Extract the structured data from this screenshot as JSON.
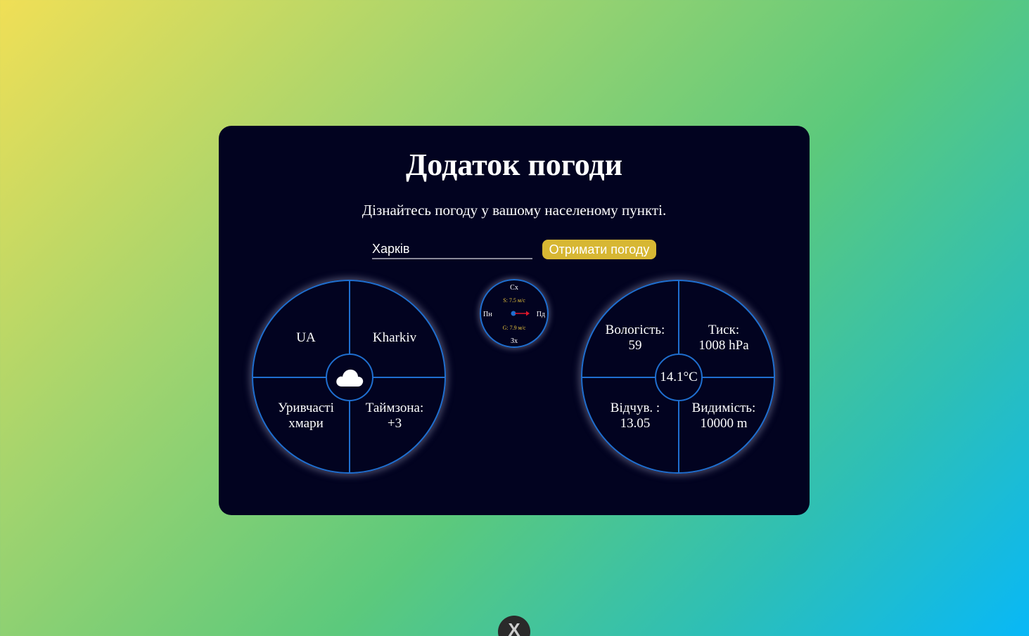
{
  "app": {
    "title": "Додаток погоди",
    "subtitle": "Дізнайтесь погоду у вашому населеному пункті."
  },
  "search": {
    "value": "Харків",
    "button_label": "Отримати погоду"
  },
  "location": {
    "country": "UA",
    "city": "Kharkiv",
    "description": "Уривчасті хмари",
    "timezone_label": "Таймзона:",
    "timezone_value": "+3",
    "weather_icon": "cloud-icon"
  },
  "wind": {
    "north": "Сх",
    "south": "Зх",
    "west": "Пн",
    "east": "Пд",
    "speed": "S: 7.5 м/с",
    "gust": "G: 7.9 м/с",
    "arrow_color": "#e0172a",
    "dot_color": "#1f6fd0"
  },
  "details": {
    "temperature": "14.1°C",
    "humidity_label": "Вологість:",
    "humidity_value": "59",
    "pressure_label": "Тиск:",
    "pressure_value": "1008 hPa",
    "feels_label": "Відчув. :",
    "feels_value": "13.05",
    "visibility_label": "Видимість:",
    "visibility_value": "10000 m"
  },
  "colors": {
    "card_bg": "#020320",
    "accent_blue": "#1f6fd0",
    "button_yellow": "#d7b733"
  },
  "floating": {
    "label": "X"
  }
}
